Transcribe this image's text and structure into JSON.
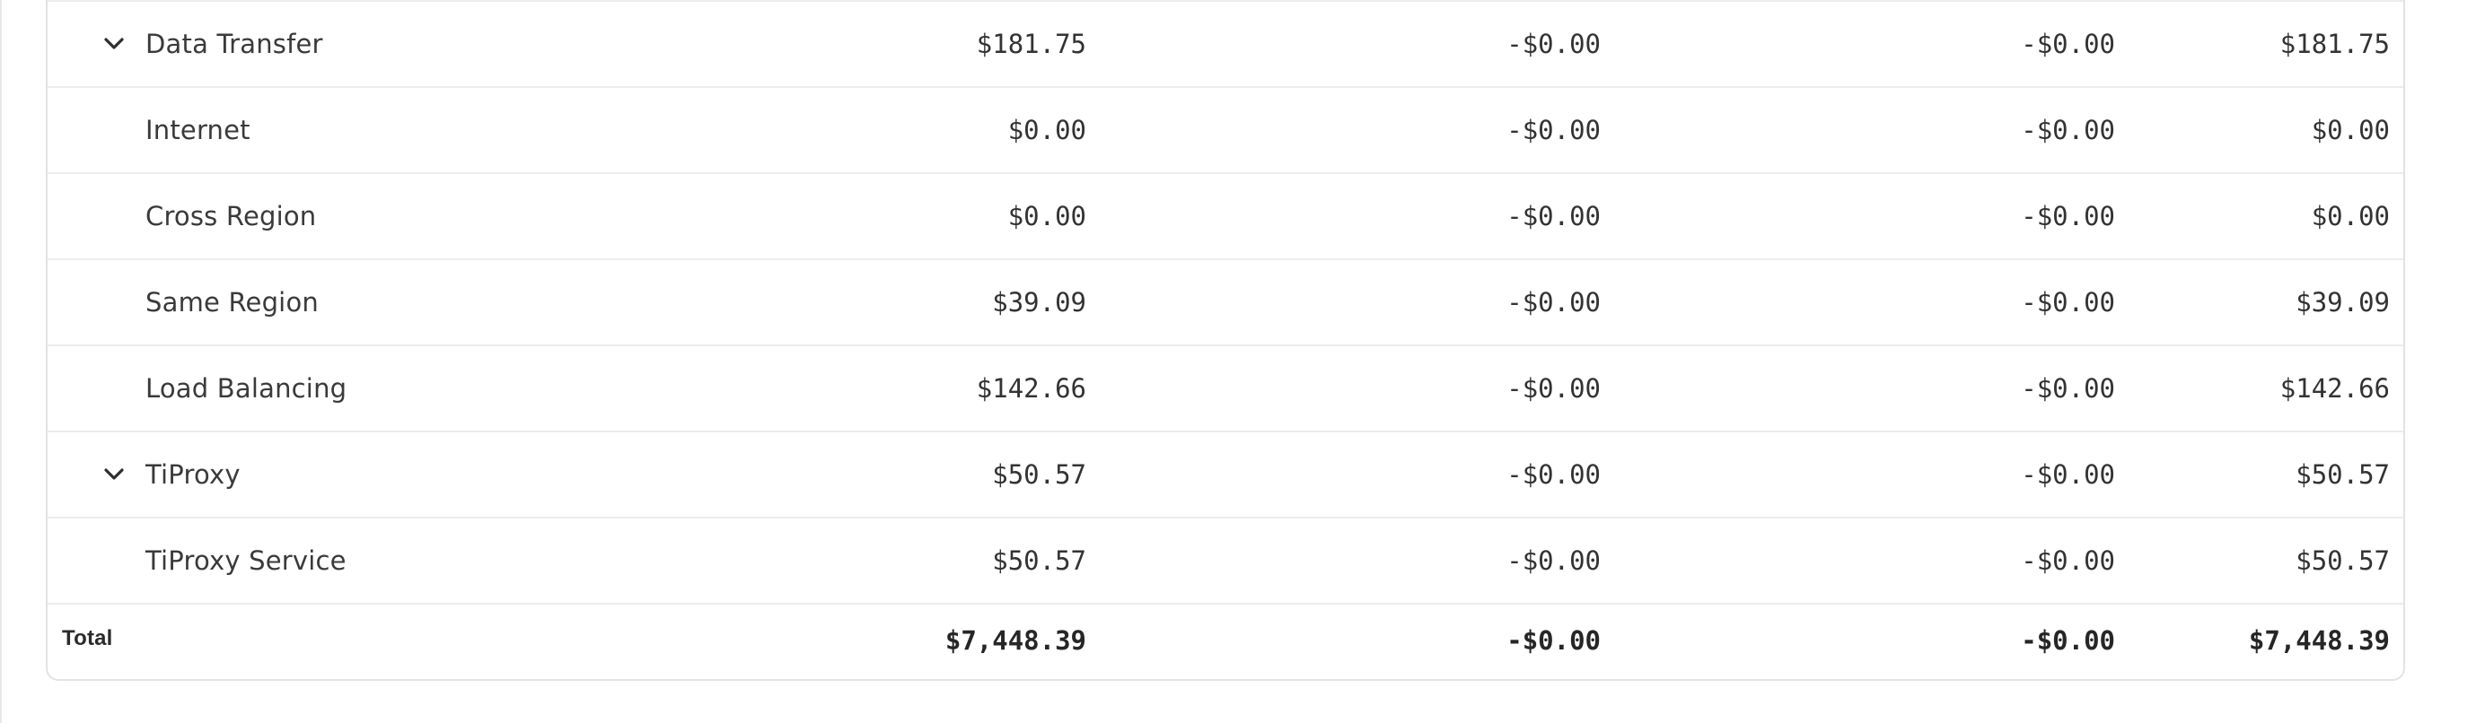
{
  "table": {
    "rows": [
      {
        "label": "Data Transfer",
        "expandable": true,
        "values": [
          "$181.75",
          "-$0.00",
          "-$0.00",
          "$181.75"
        ]
      },
      {
        "label": "Internet",
        "expandable": false,
        "values": [
          "$0.00",
          "-$0.00",
          "-$0.00",
          "$0.00"
        ]
      },
      {
        "label": "Cross Region",
        "expandable": false,
        "values": [
          "$0.00",
          "-$0.00",
          "-$0.00",
          "$0.00"
        ]
      },
      {
        "label": "Same Region",
        "expandable": false,
        "values": [
          "$39.09",
          "-$0.00",
          "-$0.00",
          "$39.09"
        ]
      },
      {
        "label": "Load Balancing",
        "expandable": false,
        "values": [
          "$142.66",
          "-$0.00",
          "-$0.00",
          "$142.66"
        ]
      },
      {
        "label": "TiProxy",
        "expandable": true,
        "values": [
          "$50.57",
          "-$0.00",
          "-$0.00",
          "$50.57"
        ]
      },
      {
        "label": "TiProxy Service",
        "expandable": false,
        "values": [
          "$50.57",
          "-$0.00",
          "-$0.00",
          "$50.57"
        ]
      }
    ],
    "total": {
      "label": "Total",
      "values": [
        "$7,448.39",
        "-$0.00",
        "-$0.00",
        "$7,448.39"
      ]
    }
  },
  "icons": {
    "expand": "chevron-down-icon"
  },
  "colors": {
    "border": "#e3e3e3",
    "row_divider": "#ececec",
    "text": "#333333"
  }
}
